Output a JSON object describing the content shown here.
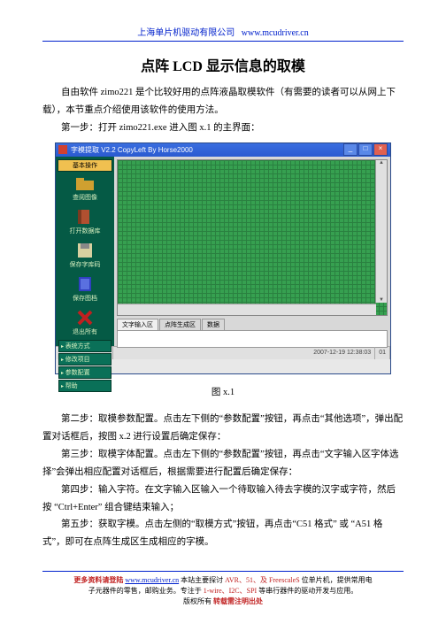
{
  "header": {
    "company": "上海单片机驱动有限公司",
    "url": "www.mcudriver.cn"
  },
  "title": "点阵 LCD 显示信息的取模",
  "intro": "自由软件 zimo221 是个比较好用的点阵液晶取模软件（有需要的读者可以从网上下载），本节重点介绍使用该软件的使用方法。",
  "step1": "第一步：打开 zimo221.exe 进入图 x.1 的主界面：",
  "screenshot": {
    "titlebar": "字模提取 V2.2  CopyLeft By Horse2000",
    "sidebar": {
      "btn_top": "基本操作",
      "items": [
        {
          "icon": "folder",
          "color": "#cfa030",
          "label": "查阅图像"
        },
        {
          "icon": "door",
          "color": "#b05030",
          "label": "打开数据库"
        },
        {
          "icon": "disk",
          "color": "#d8d0a0",
          "label": "保存字库码"
        },
        {
          "icon": "page",
          "color": "#3040c0",
          "label": "保存图档"
        },
        {
          "icon": "x",
          "color": "#c02020",
          "label": "退出所有"
        }
      ],
      "btns_bottom": [
        "表统方式",
        "修改项目",
        "参数配置",
        "帮助"
      ]
    },
    "tabs": [
      "文字输入区",
      "点阵生成区",
      "数据"
    ],
    "status_time": "2007-12-19 12:38:03",
    "status_n": "01"
  },
  "caption": "图 x.1",
  "steps": {
    "s2": "第二步：取模参数配置。点击左下侧的“参数配置”按钮，再点击“其他选项”，弹出配置对话框后，按图 x.2 进行设置后确定保存：",
    "s3": "第三步：取模字体配置。点击左下侧的“参数配置”按钮，再点击“文字输入区字体选择”会弹出相应配置对话框后，根据需要进行配置后确定保存：",
    "s4a": "第四步：输入字符。在文字输入区输入一个待取输入待去字模的汉字或字符，然后按 “Ctrl+Enter” 组合键结束输入；",
    "s5": "第五步：获取字模。点击左侧的“取模方式”按钮，再点击“C51 格式” 或 “A51 格式”，即可在点阵生成区生成相应的字模。"
  },
  "footer": {
    "line1a": "更多资料请登陆 ",
    "url": "www.mcudriver.cn",
    "line1b": " 本站主要探讨 ",
    "chips": "AVR、51、及 FreescaleS",
    "line1c": " 位单片机，提供常用电",
    "line2a": "子元器件的零售，邮购业务。专注于 ",
    "buses": "1-wire、I2C、SPI",
    "line2b": " 等串行器件的驱动开发与应用。",
    "line3a": "版权所有 ",
    "line3b": "转载需注明出处"
  }
}
